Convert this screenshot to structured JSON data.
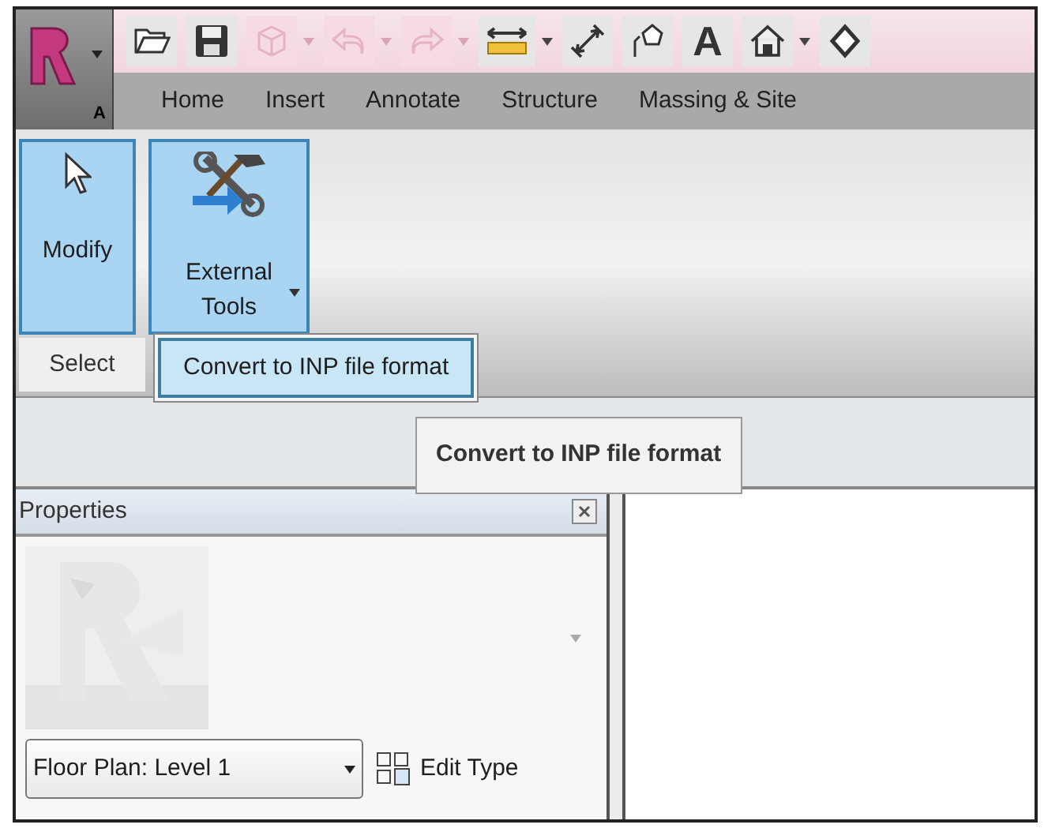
{
  "app_button": {
    "label": "A"
  },
  "quick_access": [
    {
      "disabled": false,
      "has_menu": false
    },
    {
      "disabled": false,
      "has_menu": false
    },
    {
      "disabled": true,
      "has_menu": true
    },
    {
      "disabled": true,
      "has_menu": true
    },
    {
      "disabled": true,
      "has_menu": true
    },
    {
      "disabled": false,
      "has_menu": true
    },
    {
      "disabled": false,
      "has_menu": false
    },
    {
      "disabled": false,
      "has_menu": false
    },
    {
      "disabled": false,
      "has_menu": false,
      "glyph": "A"
    },
    {
      "disabled": false,
      "has_menu": true
    },
    {
      "disabled": false,
      "has_menu": false
    }
  ],
  "tabs": [
    {
      "label": "Home"
    },
    {
      "label": "Insert"
    },
    {
      "label": "Annotate"
    },
    {
      "label": "Structure"
    },
    {
      "label": "Massing & Site"
    }
  ],
  "ribbon": {
    "buttons": [
      {
        "label": "Modify",
        "active": true,
        "has_menu": false
      },
      {
        "label": "External Tools",
        "active": true,
        "has_menu": true
      }
    ],
    "panel_label": "Select"
  },
  "dropdown_menu": {
    "items": [
      {
        "label": "Convert to INP file format",
        "selected": true
      }
    ]
  },
  "tooltip": {
    "text": "Convert to INP file format"
  },
  "properties": {
    "title": "Properties",
    "type_selector": {
      "value": "Floor Plan: Level 1"
    },
    "edit_type": "Edit Type"
  }
}
